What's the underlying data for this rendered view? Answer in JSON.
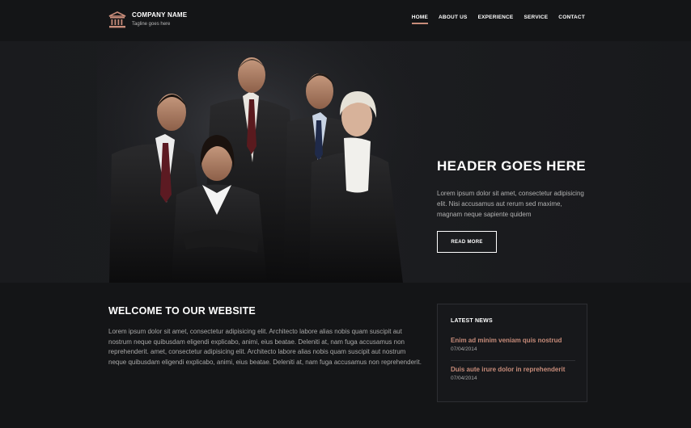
{
  "brand": {
    "name": "COMPANY NAME",
    "tagline": "Tagline goes here",
    "logo_icon": "building-columns-icon"
  },
  "nav": {
    "items": [
      "HOME",
      "ABOUT US",
      "EXPERIENCE",
      "SERVICE",
      "CONTACT"
    ],
    "active": "HOME"
  },
  "hero": {
    "title": "HEADER GOES HERE",
    "text": "Lorem ipsum dolor sit amet, consectetur adipisicing elit. Nisi accusamus aut rerum sed maxime, magnam neque sapiente quidem",
    "button": "READ MORE"
  },
  "welcome": {
    "title": "WELCOME TO OUR WEBSITE",
    "text": "Lorem ipsum dolor sit amet, consectetur adipisicing elit. Architecto labore alias nobis quam suscipit aut nostrum neque quibusdam eligendi explicabo, animi, eius beatae. Deleniti at, nam fuga accusamus non reprehenderit. amet, consectetur adipisicing elit. Architecto labore alias nobis quam suscipit aut nostrum neque quibusdam eligendi explicabo, animi, eius beatae. Deleniti at, nam fuga accusamus non reprehenderit."
  },
  "news": {
    "title": "LATEST NEWS",
    "items": [
      {
        "headline": "Enim ad minim veniam quis nostrud",
        "date": "07/04/2014"
      },
      {
        "headline": "Duis aute irure dolor in reprehenderit",
        "date": "07/04/2014"
      }
    ]
  },
  "colors": {
    "accent": "#c88c7a",
    "background": "#141517",
    "hero_background": "#1b1c1f"
  }
}
